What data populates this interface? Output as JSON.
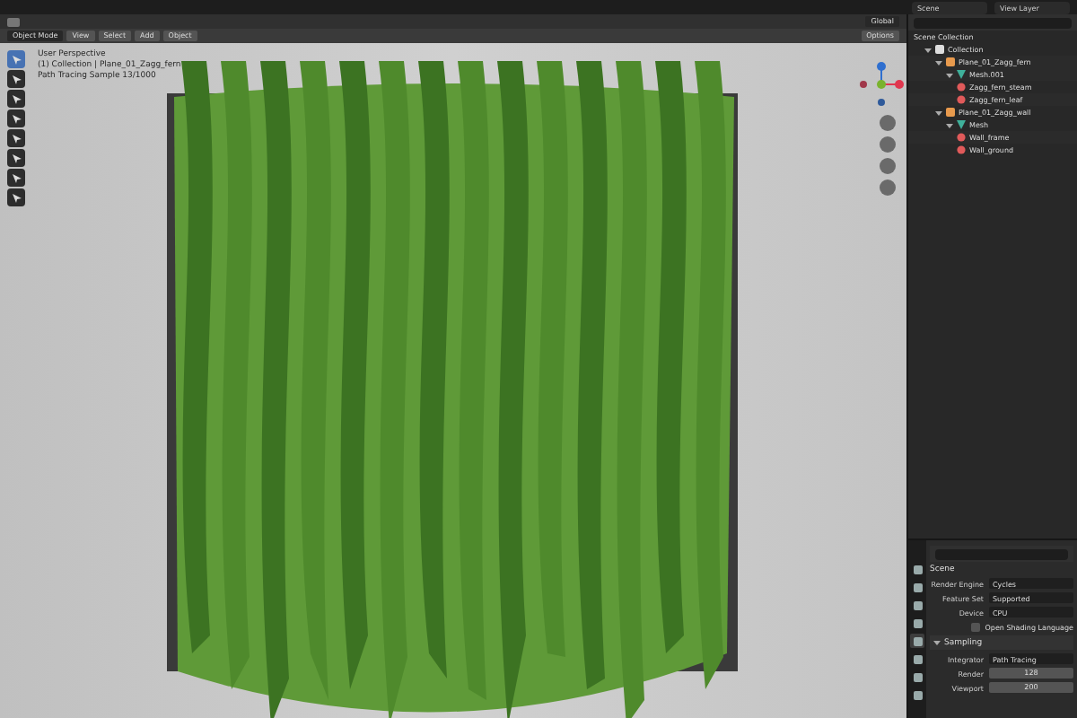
{
  "topbar": {
    "scene": "Scene",
    "view_layer": "View Layer"
  },
  "viewport": {
    "mode": "Object Mode",
    "menus": [
      "View",
      "Select",
      "Add",
      "Object"
    ],
    "orientation": "Global",
    "options": "Options",
    "overlay_lines": [
      "User Perspective",
      "(1) Collection | Plane_01_Zagg_fern",
      "Path Tracing Sample 13/1000"
    ],
    "tools": [
      {
        "selected": true
      },
      {
        "selected": false
      },
      {
        "selected": false
      },
      {
        "selected": false
      },
      {
        "selected": false
      },
      {
        "selected": false
      },
      {
        "selected": false
      },
      {
        "selected": false
      }
    ]
  },
  "outliner": {
    "root": "Scene Collection",
    "items": [
      {
        "label": "Collection",
        "kind": "collection",
        "expanded": true,
        "children": [
          {
            "label": "Plane_01_Zagg_fern",
            "kind": "object",
            "expanded": true,
            "children": [
              {
                "label": "Mesh.001",
                "kind": "mesh",
                "expanded": true,
                "children": [
                  {
                    "label": "Zagg_fern_steam",
                    "kind": "material"
                  },
                  {
                    "label": "Zagg_fern_leaf",
                    "kind": "material"
                  }
                ]
              }
            ]
          },
          {
            "label": "Plane_01_Zagg_wall",
            "kind": "object",
            "expanded": true,
            "children": [
              {
                "label": "Mesh",
                "kind": "mesh",
                "expanded": true,
                "children": [
                  {
                    "label": "Wall_frame",
                    "kind": "material"
                  },
                  {
                    "label": "Wall_ground",
                    "kind": "material"
                  }
                ]
              }
            ]
          }
        ]
      }
    ]
  },
  "properties": {
    "tabs": [
      {
        "selected": false
      },
      {
        "selected": false
      },
      {
        "selected": false
      },
      {
        "selected": false
      },
      {
        "selected": true
      },
      {
        "selected": false
      },
      {
        "selected": false
      },
      {
        "selected": false
      }
    ],
    "title": "Scene",
    "fields": [
      {
        "label": "Render Engine",
        "value": "Cycles"
      },
      {
        "label": "Feature Set",
        "value": "Supported"
      },
      {
        "label": "Device",
        "value": "CPU"
      }
    ],
    "checkbox": {
      "label": "Open Shading Language",
      "checked": false
    },
    "section": {
      "title": "Sampling",
      "expanded": true
    },
    "integrator": {
      "label": "Integrator",
      "value": "Path Tracing"
    },
    "samples": [
      {
        "label": "Render",
        "value": "128"
      },
      {
        "label": "Viewport",
        "value": "200"
      }
    ]
  }
}
